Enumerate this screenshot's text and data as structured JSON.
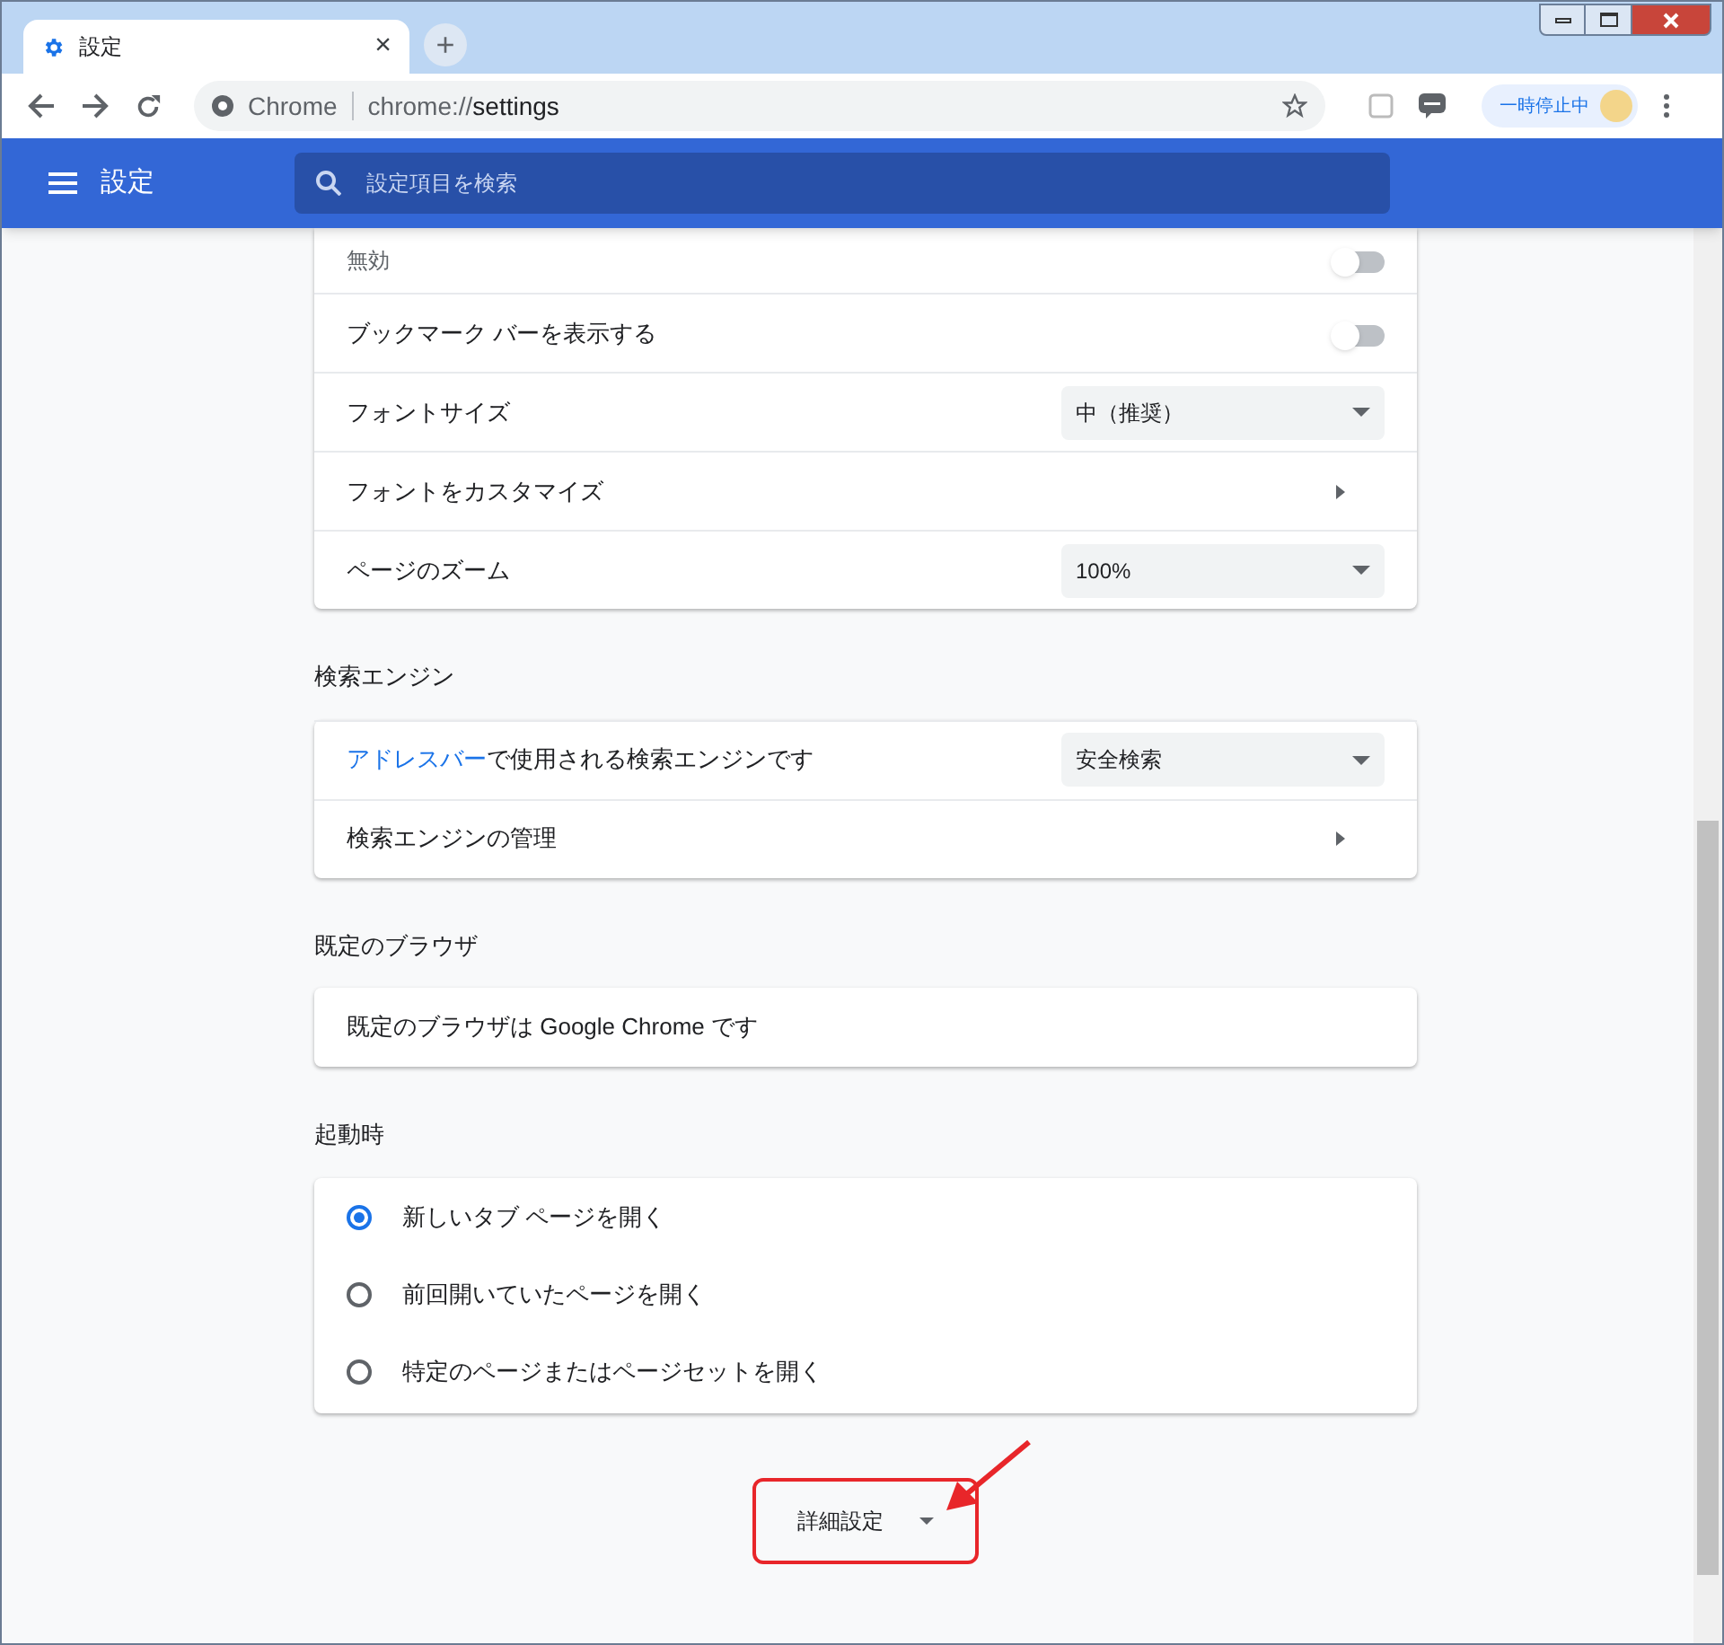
{
  "tab": {
    "title": "設定",
    "close": "×"
  },
  "new_tab": "+",
  "address": {
    "site": "Chrome",
    "url_prefix": "chrome://",
    "url_path": "settings"
  },
  "profile": {
    "label": "一時停止中"
  },
  "header": {
    "title": "設定",
    "search_placeholder": "設定項目を検索"
  },
  "appearance": [
    {
      "kind": "toggle",
      "sublabel": "無効",
      "on": false
    },
    {
      "kind": "toggle",
      "label": "ブックマーク バーを表示する",
      "on": false
    },
    {
      "kind": "select",
      "label": "フォントサイズ",
      "value": "中（推奨）"
    },
    {
      "kind": "link",
      "label": "フォントをカスタマイズ"
    },
    {
      "kind": "select",
      "label": "ページのズーム",
      "value": "100%"
    }
  ],
  "search_engine": {
    "heading": "検索エンジン",
    "rows": [
      {
        "kind": "select",
        "link": "アドレスバー",
        "label": "で使用される検索エンジンです",
        "value": "安全検索"
      },
      {
        "kind": "link",
        "label": "検索エンジンの管理"
      }
    ]
  },
  "default_browser": {
    "heading": "既定のブラウザ",
    "text": "既定のブラウザは Google Chrome です"
  },
  "startup": {
    "heading": "起動時",
    "options": [
      {
        "label": "新しいタブ ページを開く",
        "selected": true
      },
      {
        "label": "前回開いていたページを開く",
        "selected": false
      },
      {
        "label": "特定のページまたはページセットを開く",
        "selected": false
      }
    ]
  },
  "advanced": {
    "label": "詳細設定"
  }
}
